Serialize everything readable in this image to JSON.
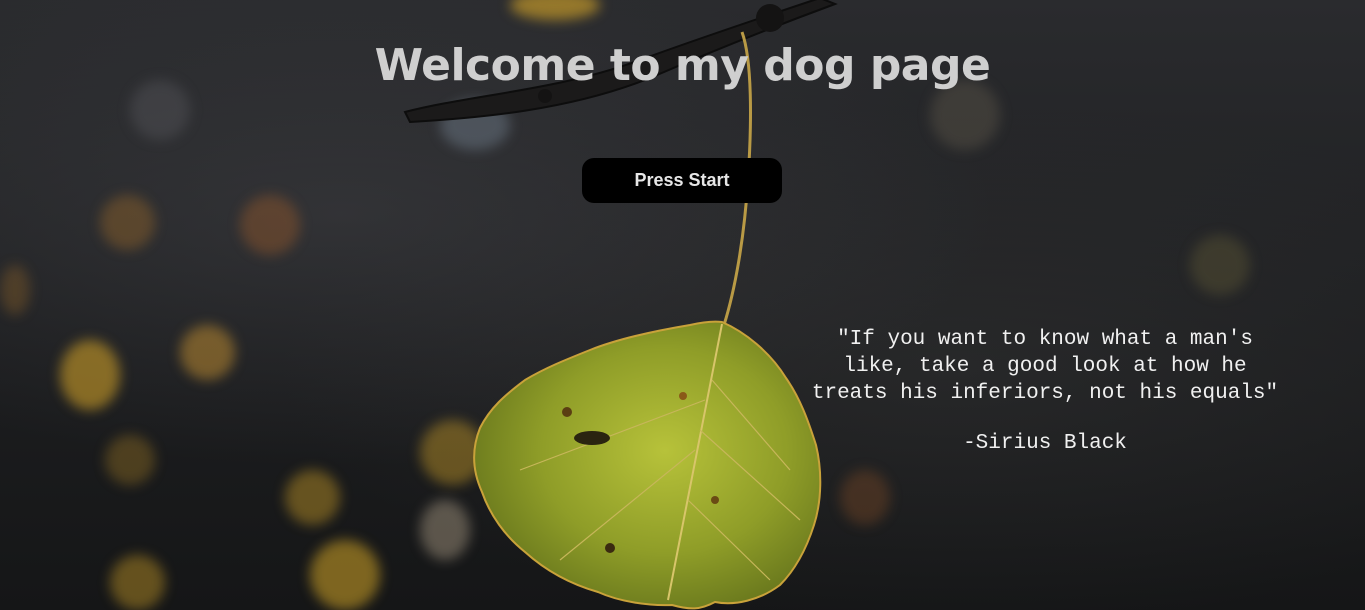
{
  "page": {
    "title": "Welcome to my dog page"
  },
  "start_button": {
    "label": "Press Start"
  },
  "quote": {
    "text": "\"If you want to know what a man's like, take a good look at how he treats his inferiors, not his equals\"",
    "author": "-Sirius Black"
  },
  "background": {
    "subject": "autumn-leaf-on-branch",
    "accent_colors": [
      "#8a9a2a",
      "#c9a23a",
      "#1a1b1d"
    ]
  }
}
